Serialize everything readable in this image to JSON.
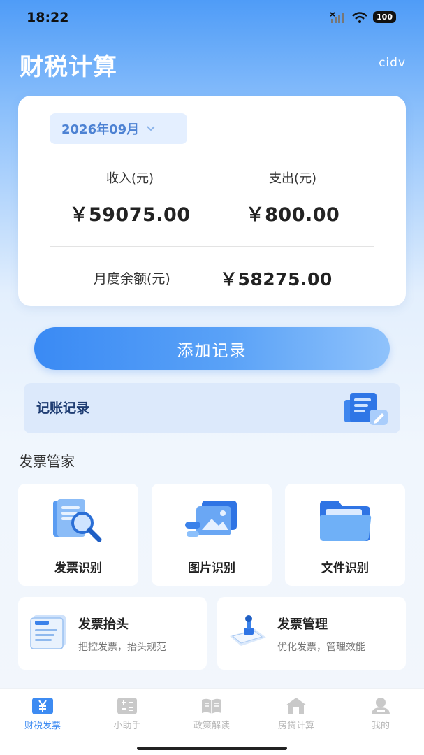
{
  "status_bar": {
    "time": "18:22",
    "battery": "100"
  },
  "header": {
    "title": "财税计算",
    "user": "cidv"
  },
  "summary": {
    "month": "2026年09月",
    "income_label": "收入(元)",
    "income_value": "￥59075.00",
    "expense_label": "支出(元)",
    "expense_value": "￥800.00",
    "balance_label": "月度余额(元)",
    "balance_value": "￥58275.00"
  },
  "add_button": {
    "label": "添加记录"
  },
  "ledger": {
    "label": "记账记录",
    "icon": "ledger-document-icon"
  },
  "invoice_section": {
    "title": "发票管家",
    "tiles": [
      {
        "label": "发票识别",
        "icon": "invoice-scan-icon"
      },
      {
        "label": "图片识别",
        "icon": "image-scan-icon"
      },
      {
        "label": "文件识别",
        "icon": "folder-icon"
      }
    ],
    "cards": [
      {
        "title": "发票抬头",
        "subtitle": "把控发票，抬头规范",
        "icon": "invoice-header-icon"
      },
      {
        "title": "发票管理",
        "subtitle": "优化发票，管理效能",
        "icon": "invoice-stamp-icon"
      }
    ]
  },
  "tab_bar": {
    "tabs": [
      {
        "label": "财税发票",
        "icon": "yuan-icon",
        "active": true
      },
      {
        "label": "小助手",
        "icon": "calculator-icon",
        "active": false
      },
      {
        "label": "政策解读",
        "icon": "book-icon",
        "active": false
      },
      {
        "label": "房贷计算",
        "icon": "house-icon",
        "active": false
      },
      {
        "label": "我的",
        "icon": "profile-icon",
        "active": false
      }
    ]
  },
  "colors": {
    "primary": "#3d8bf2",
    "title_text": "#ffffff",
    "ledger_bg": "#dce9fb"
  }
}
